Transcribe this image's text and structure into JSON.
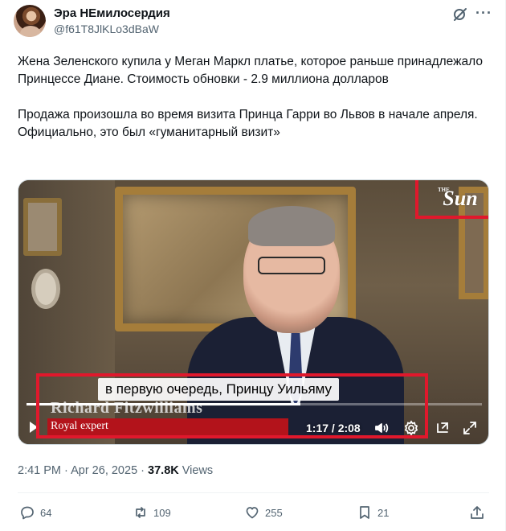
{
  "author": {
    "display_name": "Эра НЕмилосердия",
    "handle": "@f61T8JlKLo3dBaW"
  },
  "tweet": {
    "paragraph_1": "Жена Зеленского купила у Меган Маркл платье, которое раньше принадлежало Принцессе Диане. Стоимость обновки - 2.9 миллиона долларов",
    "paragraph_2": "Продажа произошла во время визита Принца Гарри во Львов в начале апреля. Официально, это был «гуманитарный визит»"
  },
  "video": {
    "logo_small": "THE",
    "logo": "Sun",
    "subtitle": "в первую очередь, Принцу Уильяму",
    "lower_third_name": "Richard Fitzwilliams",
    "lower_third_role": "Royal expert",
    "timecode": "1:17 / 2:08",
    "progress_fraction": 0.602
  },
  "meta": {
    "time": "2:41 PM",
    "separator": " · ",
    "date": "Apr 26, 2025",
    "views_count": "37.8K",
    "views_label": "Views"
  },
  "actions": {
    "replies": "64",
    "reposts": "109",
    "likes": "255",
    "bookmarks": "21"
  },
  "colors": {
    "highlight": "#e0182c",
    "text_secondary": "#536471",
    "lower_third_bar": "#b3131b"
  }
}
